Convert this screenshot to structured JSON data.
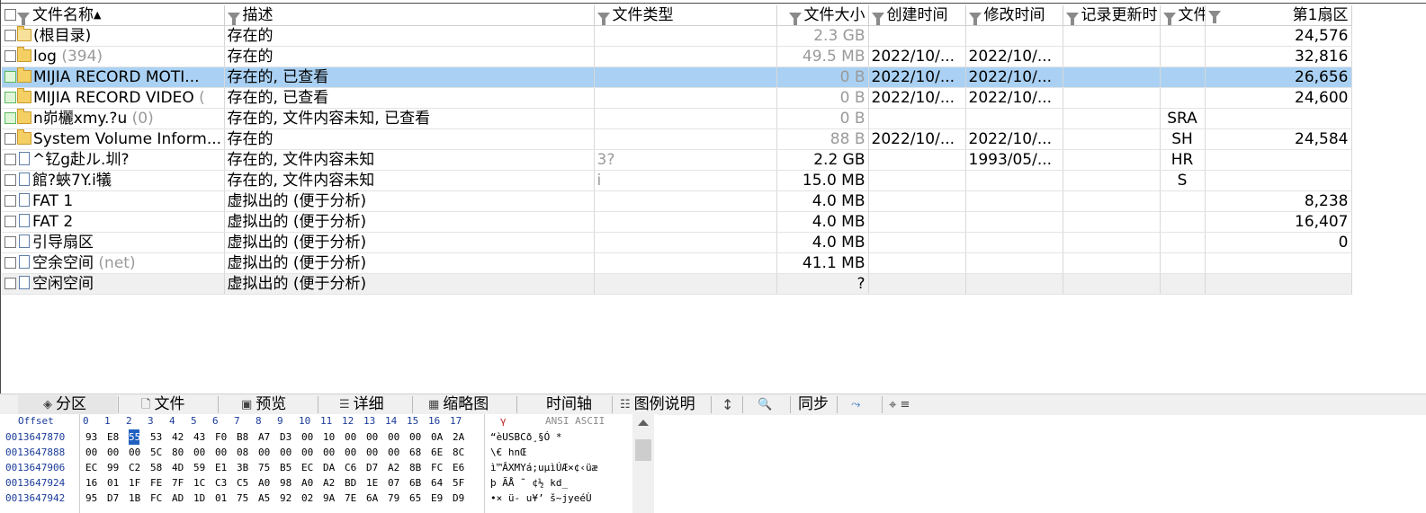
{
  "columns": [
    "文件名称",
    "描述",
    "文件类型",
    "文件大小",
    "创建时间",
    "修改时间",
    "记录更新时",
    "文件",
    "第1扇区"
  ],
  "rows": [
    {
      "name": "(根目录)",
      "count": "",
      "desc": "存在的",
      "type": "",
      "size": "2.3 GB",
      "created": "",
      "modified": "",
      "updated": "",
      "attr": "",
      "sector": "24,576"
    },
    {
      "name": "log",
      "count": "(394)",
      "desc": "存在的",
      "type": "",
      "size": "49.5 MB",
      "created": "2022/10/...",
      "modified": "2022/10/...",
      "updated": "",
      "attr": "",
      "sector": "32,816"
    },
    {
      "name": "MIJIA RECORD MOTI...",
      "count": "",
      "desc": "存在的, 已查看",
      "type": "",
      "size": "0 B",
      "created": "2022/10/...",
      "modified": "2022/10/...",
      "updated": "",
      "attr": "",
      "sector": "26,656"
    },
    {
      "name": "MIJIA RECORD VIDEO",
      "count": "(",
      "desc": "存在的, 已查看",
      "type": "",
      "size": "0 B",
      "created": "2022/10/...",
      "modified": "2022/10/...",
      "updated": "",
      "attr": "",
      "sector": "24,600"
    },
    {
      "name": "n峁欐xmy.?u",
      "count": "(0)",
      "desc": "存在的, 文件内容未知, 已查看",
      "type": "",
      "size": "0 B",
      "created": "",
      "modified": "",
      "updated": "",
      "attr": "SRA",
      "sector": ""
    },
    {
      "name": "System Volume Inform...",
      "count": "",
      "desc": "存在的",
      "type": "",
      "size": "88 B",
      "created": "2022/10/...",
      "modified": "2022/10/...",
      "updated": "",
      "attr": "SH",
      "sector": "24,584"
    },
    {
      "name": "^钇g赴ル.圳?",
      "count": "",
      "desc": "存在的, 文件内容未知",
      "type": "3?",
      "size": "2.2 GB",
      "created": "",
      "modified": "1993/05/...",
      "updated": "",
      "attr": "HR",
      "sector": ""
    },
    {
      "name": "館?蛺7Y.i犠",
      "count": "",
      "desc": "存在的, 文件内容未知",
      "type": "i",
      "size": "15.0 MB",
      "created": "",
      "modified": "",
      "updated": "",
      "attr": "S",
      "sector": ""
    },
    {
      "name": "FAT 1",
      "count": "",
      "desc": "虚拟出的 (便于分析)",
      "type": "",
      "size": "4.0 MB",
      "created": "",
      "modified": "",
      "updated": "",
      "attr": "",
      "sector": "8,238"
    },
    {
      "name": "FAT 2",
      "count": "",
      "desc": "虚拟出的 (便于分析)",
      "type": "",
      "size": "4.0 MB",
      "created": "",
      "modified": "",
      "updated": "",
      "attr": "",
      "sector": "16,407"
    },
    {
      "name": "引导扇区",
      "count": "",
      "desc": "虚拟出的 (便于分析)",
      "type": "",
      "size": "4.0 MB",
      "created": "",
      "modified": "",
      "updated": "",
      "attr": "",
      "sector": "0"
    },
    {
      "name": "空余空间",
      "count": "(net)",
      "desc": "虚拟出的 (便于分析)",
      "type": "",
      "size": "41.1 MB",
      "created": "",
      "modified": "",
      "updated": "",
      "attr": "",
      "sector": ""
    },
    {
      "name": "空闲空间",
      "count": "",
      "desc": "虚拟出的 (便于分析)",
      "type": "",
      "size": "?",
      "created": "",
      "modified": "",
      "updated": "",
      "attr": "",
      "sector": ""
    }
  ],
  "tabs": {
    "partition": "分区",
    "file": "文件",
    "preview": "预览",
    "details": "详细",
    "thumbnail": "缩略图",
    "timeline": "时间轴",
    "legend": "图例说明",
    "sync": "同步"
  },
  "hex": {
    "offset_label": "Offset",
    "column_labels": [
      "0",
      "1",
      "2",
      "3",
      "4",
      "5",
      "6",
      "7",
      "8",
      "9",
      "10",
      "11",
      "12",
      "13",
      "14",
      "15",
      "16",
      "17"
    ],
    "mode_label": "ANSI ASCII",
    "rows": [
      {
        "offset": "0013647870",
        "bytes": [
          "93",
          "E8",
          "55",
          "53",
          "42",
          "43",
          "F0",
          "B8",
          "A7",
          "D3",
          "00",
          "10",
          "00",
          "00",
          "00",
          "00",
          "0A",
          "2A"
        ],
        "ascii": "“èUSBCð¸§Ó       *"
      },
      {
        "offset": "0013647888",
        "bytes": [
          "00",
          "00",
          "00",
          "5C",
          "80",
          "00",
          "00",
          "08",
          "00",
          "00",
          "00",
          "00",
          "00",
          "00",
          "00",
          "68",
          "6E",
          "8C"
        ],
        "ascii": "   \\€          hnŒ"
      },
      {
        "offset": "0013647906",
        "bytes": [
          "EC",
          "99",
          "C2",
          "58",
          "4D",
          "59",
          "E1",
          "3B",
          "75",
          "B5",
          "EC",
          "DA",
          "C6",
          "D7",
          "A2",
          "8B",
          "FC",
          "E6"
        ],
        "ascii": "ì™ÂXMYá;uµìÚÆ×¢‹üæ"
      },
      {
        "offset": "0013647924",
        "bytes": [
          "16",
          "01",
          "1F",
          "FE",
          "7F",
          "1C",
          "C3",
          "C5",
          "A0",
          "98",
          "A0",
          "A2",
          "BD",
          "1E",
          "07",
          "6B",
          "64",
          "5F"
        ],
        "ascii": "   þ  ÃÅ ˜ ¢½  kd_"
      },
      {
        "offset": "0013647942",
        "bytes": [
          "95",
          "D7",
          "1B",
          "FC",
          "AD",
          "1D",
          "01",
          "75",
          "A5",
          "92",
          "02",
          "9A",
          "7E",
          "6A",
          "79",
          "65",
          "E9",
          "D9"
        ],
        "ascii": "•× ü-  u¥’ š~jyeéÙ"
      }
    ]
  }
}
